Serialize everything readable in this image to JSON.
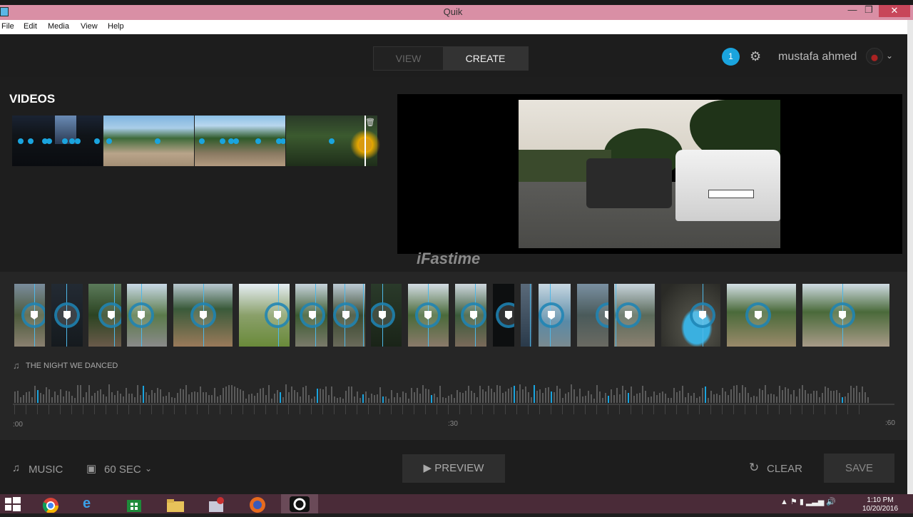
{
  "window": {
    "title": "Quik"
  },
  "menu": [
    "File",
    "Edit",
    "Media",
    "View",
    "Help"
  ],
  "header": {
    "tabs": {
      "view": "VIEW",
      "create": "CREATE",
      "active": "CREATE"
    },
    "notification_count": "1",
    "username": "mustafa ahmed"
  },
  "videos": {
    "title": "VIDEOS"
  },
  "watermark": "iFastime",
  "song": {
    "title": "THE NIGHT WE DANCED"
  },
  "timeline": {
    "ticks": [
      ":00",
      ":30",
      ":60"
    ]
  },
  "bottom": {
    "music_label": "MUSIC",
    "duration_label": "60 SEC",
    "preview_label": "PREVIEW",
    "clear_label": "CLEAR",
    "save_label": "SAVE"
  },
  "taskbar": {
    "time": "1:10 PM",
    "date": "10/20/2016"
  },
  "colors": {
    "accent": "#1aa4de",
    "selection": "#e8a800"
  }
}
